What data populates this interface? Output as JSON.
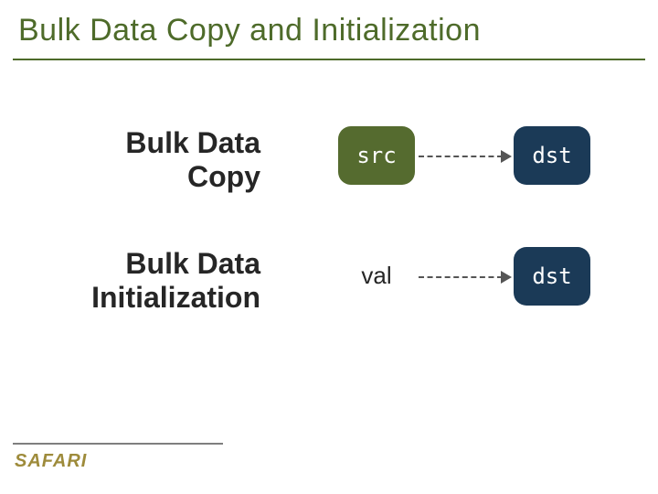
{
  "title": "Bulk Data Copy and Initialization",
  "rows": [
    {
      "label_line1": "Bulk Data",
      "label_line2": "Copy",
      "left_kind": "chip",
      "left_text": "src",
      "right_text": "dst"
    },
    {
      "label_line1": "Bulk Data",
      "label_line2": "Initialization",
      "left_kind": "text",
      "left_text": "val",
      "right_text": "dst"
    }
  ],
  "footer_brand": "SAFARI",
  "colors": {
    "title": "#4e6b2a",
    "src_chip": "#556b2f",
    "dst_chip": "#1b3a57",
    "brand": "#9e8b3b"
  }
}
